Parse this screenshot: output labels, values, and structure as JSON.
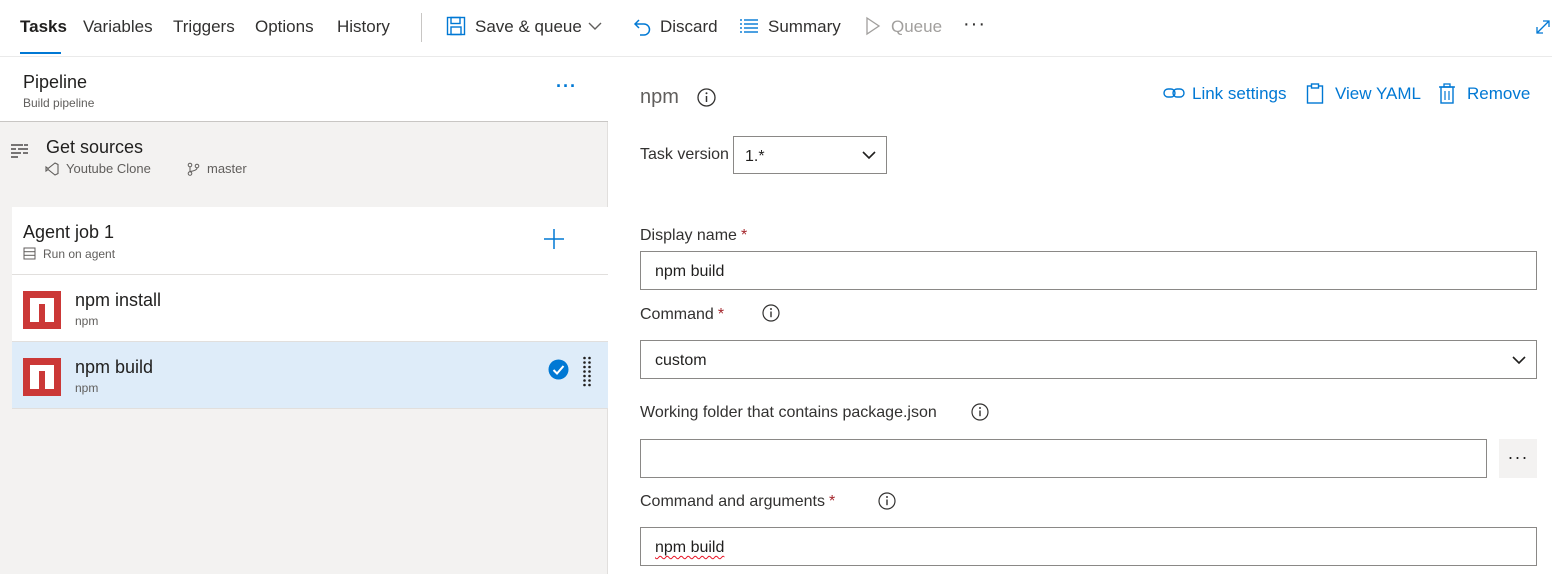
{
  "tabs": [
    {
      "label": "Tasks",
      "active": true
    },
    {
      "label": "Variables"
    },
    {
      "label": "Triggers"
    },
    {
      "label": "Options"
    },
    {
      "label": "History"
    }
  ],
  "toolbar": {
    "save_queue": "Save & queue",
    "discard": "Discard",
    "summary": "Summary",
    "queue": "Queue",
    "more": "···"
  },
  "pipeline": {
    "title": "Pipeline",
    "subtitle": "Build pipeline",
    "more": "···"
  },
  "get_sources": {
    "title": "Get sources",
    "repo": "Youtube Clone",
    "branch": "master"
  },
  "agent_job": {
    "title": "Agent job 1",
    "subtitle": "Run on agent"
  },
  "tasks": [
    {
      "title": "npm install",
      "subtitle": "npm",
      "selected": false
    },
    {
      "title": "npm build",
      "subtitle": "npm",
      "selected": true
    }
  ],
  "detail": {
    "title": "npm",
    "link_settings": "Link settings",
    "view_yaml": "View YAML",
    "remove": "Remove",
    "task_version_label": "Task version",
    "task_version_value": "1.*",
    "display_name_label": "Display name",
    "display_name_value": "npm build",
    "command_label": "Command",
    "command_value": "custom",
    "working_folder_label": "Working folder that contains package.json",
    "working_folder_value": "",
    "browse": "···",
    "command_args_label": "Command and arguments",
    "command_args_value": "npm build",
    "required_marker": "*"
  },
  "colors": {
    "accent": "#0078d4",
    "npm_red": "#cb3837",
    "selected_row": "#deecf9",
    "required": "#a4262c"
  }
}
